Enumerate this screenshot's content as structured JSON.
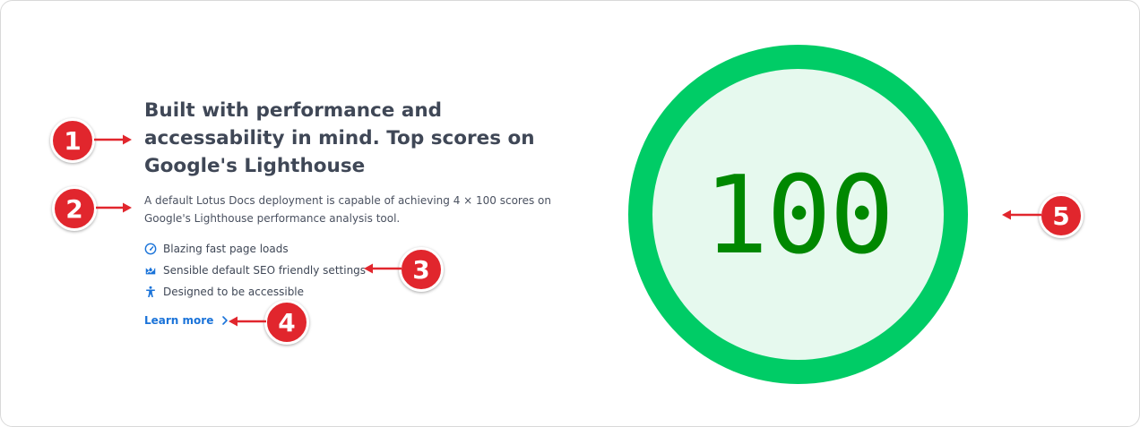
{
  "heading": "Built with performance and accessability in mind. Top scores on Google's Lighthouse",
  "description": "A default Lotus Docs deployment is capable of achieving 4 × 100 scores on Google's Lighthouse performance analysis tool.",
  "features": [
    {
      "icon": "speedometer-icon",
      "label": "Blazing fast page loads"
    },
    {
      "icon": "seo-icon",
      "label": "Sensible default SEO friendly settings"
    },
    {
      "icon": "accessibility-icon",
      "label": "Designed to be accessible"
    }
  ],
  "learn_more": {
    "label": "Learn more",
    "icon": "chevron-right-icon"
  },
  "gauge": {
    "score": "100",
    "ring_color": "#00cc66",
    "fill_color": "#e6f9ee",
    "text_color": "#008800"
  },
  "annotations": [
    "1",
    "2",
    "3",
    "4",
    "5"
  ],
  "colors": {
    "accent": "#1a73d9",
    "annotation": "#e1262d",
    "text": "#3f4756"
  }
}
